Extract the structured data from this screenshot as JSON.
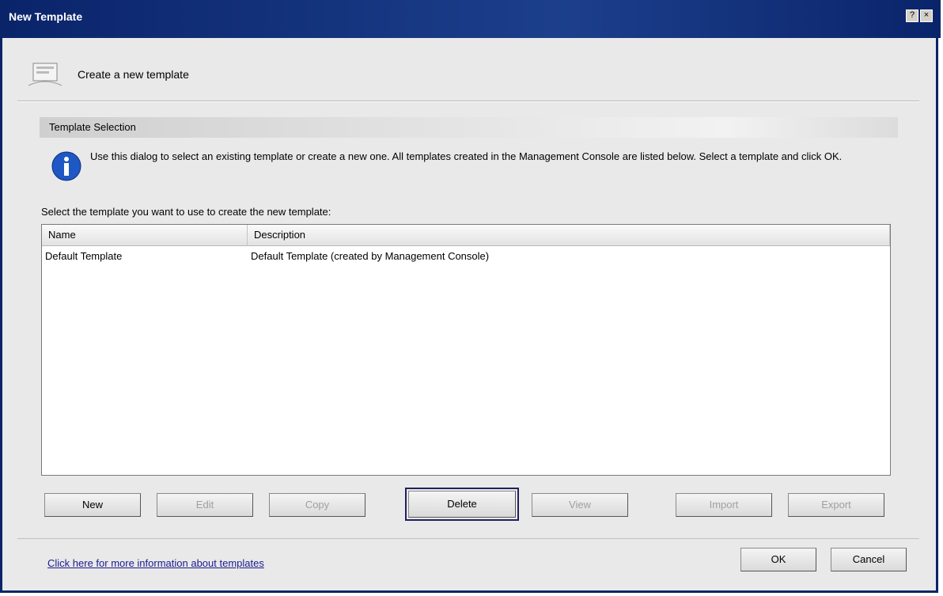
{
  "window": {
    "title": "New Template",
    "controls": [
      "?",
      "×"
    ]
  },
  "header": {
    "title": "Create a new template",
    "icon": "template-wizard-icon"
  },
  "section": {
    "title": "Template Selection"
  },
  "info": {
    "icon": "info-icon",
    "text": "Use this dialog to select an existing template or create a new one. All templates created in the Management Console are listed below. Select a template and click OK."
  },
  "list": {
    "instruction": "Select the template you want to use to create the new template:",
    "columns": [
      "Name",
      "Description"
    ],
    "rows": [
      {
        "name": "Default Template",
        "description": "Default Template (created by Management Console)"
      }
    ]
  },
  "buttons": {
    "new": "New",
    "edit": "Edit",
    "copy": "Copy",
    "delete": "Delete",
    "view": "View",
    "import": "Import",
    "export": "Export"
  },
  "footer": {
    "link": "Click here for more information about templates",
    "ok": "OK",
    "cancel": "Cancel"
  }
}
